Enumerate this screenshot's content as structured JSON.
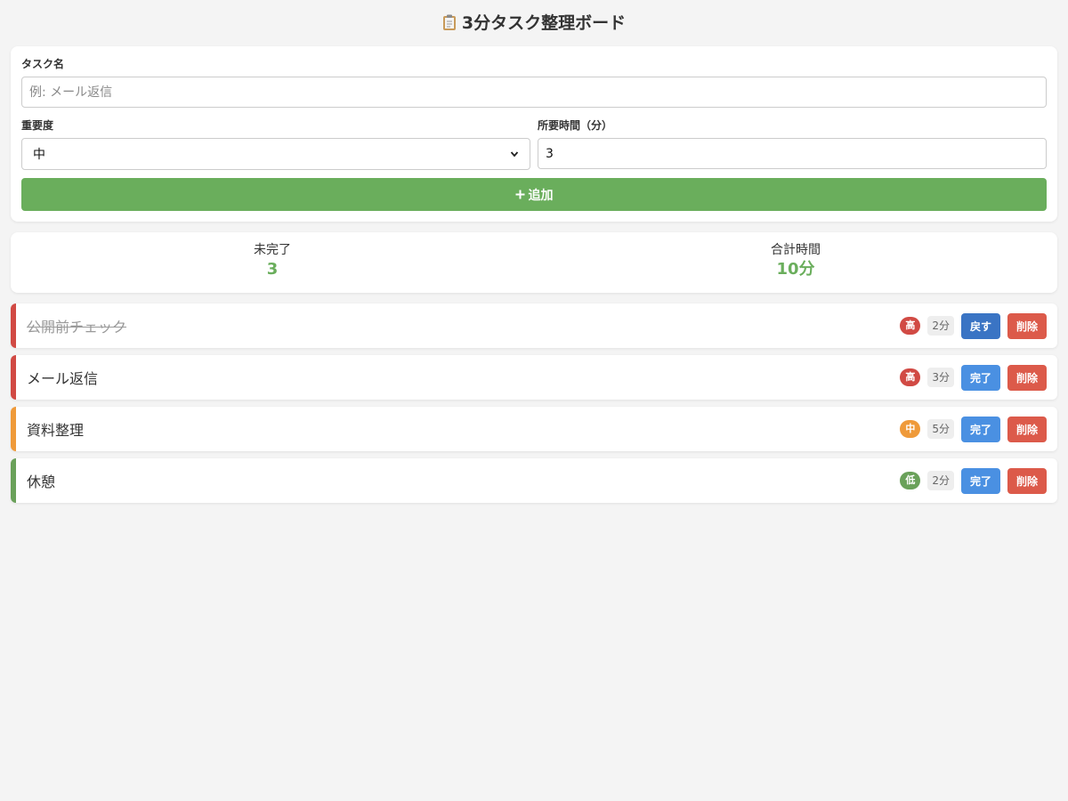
{
  "header": {
    "title": "3分タスク整理ボード"
  },
  "form": {
    "name_label": "タスク名",
    "name_placeholder": "例: メール返信",
    "name_value": "",
    "importance_label": "重要度",
    "importance_value": "中",
    "duration_label": "所要時間（分）",
    "duration_value": "3",
    "add_label": "追加"
  },
  "stats": {
    "incomplete_label": "未完了",
    "incomplete_value": "3",
    "total_label": "合計時間",
    "total_value": "10分"
  },
  "tasks": [
    {
      "name": "公開前チェック",
      "done": true,
      "priority": "高",
      "priority_color": "#d14a44",
      "minutes": "2分",
      "toggle_label": "戻す",
      "toggle_color": "#3a74c4",
      "delete_label": "削除"
    },
    {
      "name": "メール返信",
      "done": false,
      "priority": "高",
      "priority_color": "#d14a44",
      "minutes": "3分",
      "toggle_label": "完了",
      "toggle_color": "#4a90e2",
      "delete_label": "削除"
    },
    {
      "name": "資料整理",
      "done": false,
      "priority": "中",
      "priority_color": "#ef9a3a",
      "minutes": "5分",
      "toggle_label": "完了",
      "toggle_color": "#4a90e2",
      "delete_label": "削除"
    },
    {
      "name": "休憩",
      "done": false,
      "priority": "低",
      "priority_color": "#6aa15a",
      "minutes": "2分",
      "toggle_label": "完了",
      "toggle_color": "#4a90e2",
      "delete_label": "削除"
    }
  ],
  "colors": {
    "accent_green": "#6aae5c",
    "delete_red": "#dc5a4a"
  },
  "icons": {
    "title_icon": "clipboard-icon",
    "add_icon": "plus-icon",
    "select_icon": "chevron-down-icon"
  }
}
